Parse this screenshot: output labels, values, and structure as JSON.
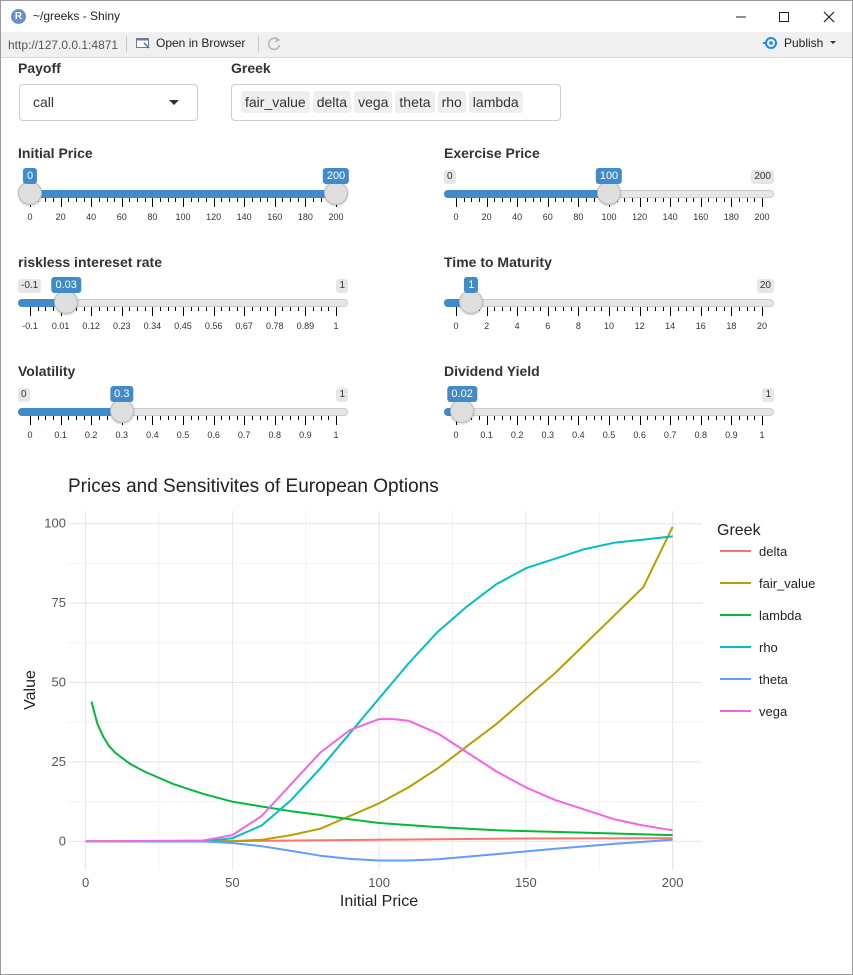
{
  "window": {
    "title": "~/greeks - Shiny"
  },
  "toolbar": {
    "url": "http://127.0.0.1:4871",
    "open_browser": "Open in Browser",
    "publish": "Publish"
  },
  "inputs": {
    "payoff": {
      "label": "Payoff",
      "value": "call"
    },
    "greek": {
      "label": "Greek",
      "chips": [
        "fair_value",
        "delta",
        "vega",
        "theta",
        "rho",
        "lambda"
      ]
    }
  },
  "sliders": [
    {
      "id": "initial-price",
      "label": "Initial Price",
      "min": 0,
      "max": 200,
      "range": true,
      "from": 0,
      "to": 200,
      "min_label": "0",
      "max_label": "200",
      "value_label": "0",
      "value2_label": "200",
      "ticks": [
        "0",
        "20",
        "40",
        "60",
        "80",
        "100",
        "120",
        "140",
        "160",
        "180",
        "200"
      ]
    },
    {
      "id": "exercise-price",
      "label": "Exercise Price",
      "min": 0,
      "max": 200,
      "value": 100,
      "min_label": "0",
      "max_label": "200",
      "value_label": "100",
      "ticks": [
        "0",
        "20",
        "40",
        "60",
        "80",
        "100",
        "120",
        "140",
        "160",
        "180",
        "200"
      ]
    },
    {
      "id": "riskless-rate",
      "label": "riskless intereset rate",
      "min": -0.1,
      "max": 1,
      "value": 0.03,
      "min_label": "-0.1",
      "max_label": "1",
      "value_label": "0.03",
      "ticks": [
        "-0.1",
        "0.01",
        "0.12",
        "0.23",
        "0.34",
        "0.45",
        "0.56",
        "0.67",
        "0.78",
        "0.89",
        "1"
      ]
    },
    {
      "id": "time-to-maturity",
      "label": "Time to Maturity",
      "min": 0,
      "max": 20,
      "value": 1,
      "min_label": "0",
      "max_label": "20",
      "value_label": "1",
      "ticks": [
        "0",
        "2",
        "4",
        "6",
        "8",
        "10",
        "12",
        "14",
        "16",
        "18",
        "20"
      ]
    },
    {
      "id": "volatility",
      "label": "Volatility",
      "min": 0,
      "max": 1,
      "value": 0.3,
      "min_label": "0",
      "max_label": "1",
      "value_label": "0.3",
      "ticks": [
        "0",
        "0.1",
        "0.2",
        "0.3",
        "0.4",
        "0.5",
        "0.6",
        "0.7",
        "0.8",
        "0.9",
        "1"
      ]
    },
    {
      "id": "dividend-yield",
      "label": "Dividend Yield",
      "min": 0,
      "max": 1,
      "value": 0.02,
      "min_label": "0",
      "max_label": "1",
      "value_label": "0.02",
      "ticks": [
        "0",
        "0.1",
        "0.2",
        "0.3",
        "0.4",
        "0.5",
        "0.6",
        "0.7",
        "0.8",
        "0.9",
        "1"
      ]
    }
  ],
  "chart_data": {
    "type": "line",
    "title": "Prices and Sensitivites of European Options",
    "xlabel": "Initial Price",
    "ylabel": "Value",
    "xlim": [
      -6,
      210
    ],
    "ylim": [
      -9,
      104
    ],
    "xticks": [
      0,
      50,
      100,
      150,
      200
    ],
    "yticks": [
      0,
      25,
      50,
      75,
      100
    ],
    "grid": true,
    "legend_title": "Greek",
    "legend_position": "right",
    "series": [
      {
        "name": "delta",
        "color": "#F8766D",
        "x": [
          0,
          50,
          100,
          150,
          200
        ],
        "y": [
          0,
          0.1,
          0.5,
          0.9,
          1
        ]
      },
      {
        "name": "fair_value",
        "color": "#B79F00",
        "x": [
          0,
          40,
          50,
          60,
          70,
          80,
          90,
          100,
          110,
          120,
          130,
          140,
          150,
          160,
          170,
          180,
          190,
          200
        ],
        "y": [
          0,
          0,
          0.1,
          0.5,
          2,
          4,
          8,
          12,
          17,
          23,
          30,
          37,
          45,
          53,
          62,
          71,
          80,
          99
        ]
      },
      {
        "name": "lambda",
        "color": "#00BA38",
        "x": [
          2,
          4,
          6,
          8,
          10,
          15,
          20,
          30,
          40,
          50,
          60,
          70,
          80,
          90,
          100,
          120,
          140,
          160,
          180,
          200
        ],
        "y": [
          44,
          37,
          33,
          30,
          28,
          24.5,
          22,
          18,
          15,
          12.5,
          11,
          9.5,
          8.3,
          7,
          5.8,
          4.5,
          3.5,
          3,
          2.5,
          2
        ]
      },
      {
        "name": "rho",
        "color": "#00BFC4",
        "x": [
          0,
          40,
          50,
          60,
          70,
          80,
          90,
          100,
          110,
          120,
          130,
          140,
          150,
          160,
          170,
          180,
          190,
          200
        ],
        "y": [
          0,
          0,
          1,
          5,
          13,
          23,
          34,
          45,
          56,
          66,
          74,
          81,
          86,
          89,
          92,
          94,
          95,
          96
        ]
      },
      {
        "name": "theta",
        "color": "#619CFF",
        "x": [
          0,
          40,
          50,
          60,
          70,
          80,
          90,
          100,
          110,
          120,
          140,
          160,
          180,
          200
        ],
        "y": [
          0,
          0,
          -0.5,
          -1.5,
          -3,
          -4.5,
          -5.5,
          -6,
          -6,
          -5.6,
          -4,
          -2.3,
          -0.8,
          0.5
        ]
      },
      {
        "name": "vega",
        "color": "#F564E3",
        "x": [
          0,
          40,
          50,
          60,
          70,
          80,
          90,
          100,
          105,
          110,
          120,
          130,
          140,
          150,
          160,
          170,
          180,
          190,
          200
        ],
        "y": [
          0,
          0.3,
          2,
          8,
          18,
          28,
          35,
          38.5,
          38.5,
          38,
          34,
          28,
          22,
          17,
          13,
          10,
          7,
          5,
          3.5
        ]
      }
    ]
  }
}
